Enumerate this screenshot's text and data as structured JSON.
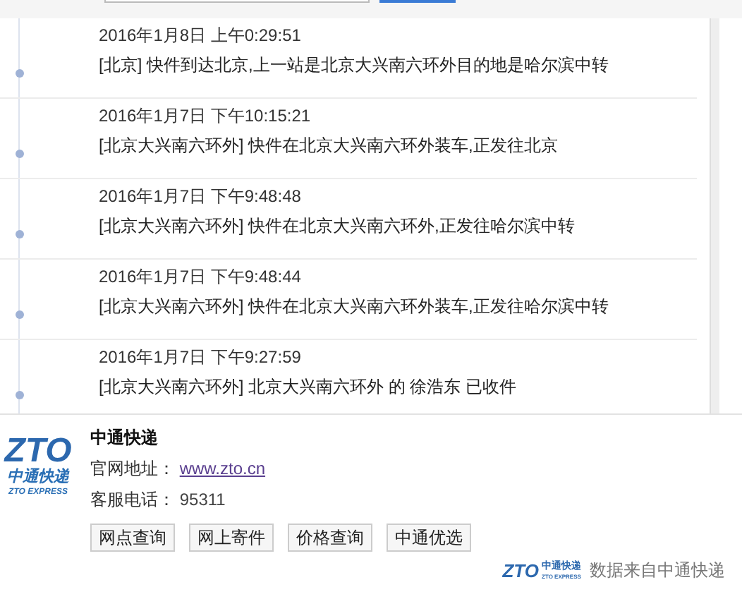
{
  "events": [
    {
      "time": "2016年1月8日 上午0:29:51",
      "text": "[北京] 快件到达北京,上一站是北京大兴南六环外目的地是哈尔滨中转"
    },
    {
      "time": "2016年1月7日 下午10:15:21",
      "text": "[北京大兴南六环外] 快件在北京大兴南六环外装车,正发往北京"
    },
    {
      "time": "2016年1月7日 下午9:48:48",
      "text": "[北京大兴南六环外] 快件在北京大兴南六环外,正发往哈尔滨中转"
    },
    {
      "time": "2016年1月7日 下午9:48:44",
      "text": "[北京大兴南六环外] 快件在北京大兴南六环外装车,正发往哈尔滨中转"
    },
    {
      "time": "2016年1月7日 下午9:27:59",
      "text": "[北京大兴南六环外] 北京大兴南六环外 的 徐浩东 已收件"
    }
  ],
  "company": {
    "logo": {
      "mark": "ZTO",
      "name": "中通快递",
      "tagline": "ZTO EXPRESS"
    },
    "name": "中通快递",
    "website_label": "官网地址：",
    "website": "www.zto.cn",
    "phone_label": "客服电话：",
    "phone": "95311",
    "buttons": [
      "网点查询",
      "网上寄件",
      "价格查询",
      "中通优选"
    ],
    "source_logo": {
      "mark": "ZTO",
      "name": "中通快递",
      "tagline": "ZTO EXPRESS"
    },
    "source": "数据来自中通快递"
  }
}
